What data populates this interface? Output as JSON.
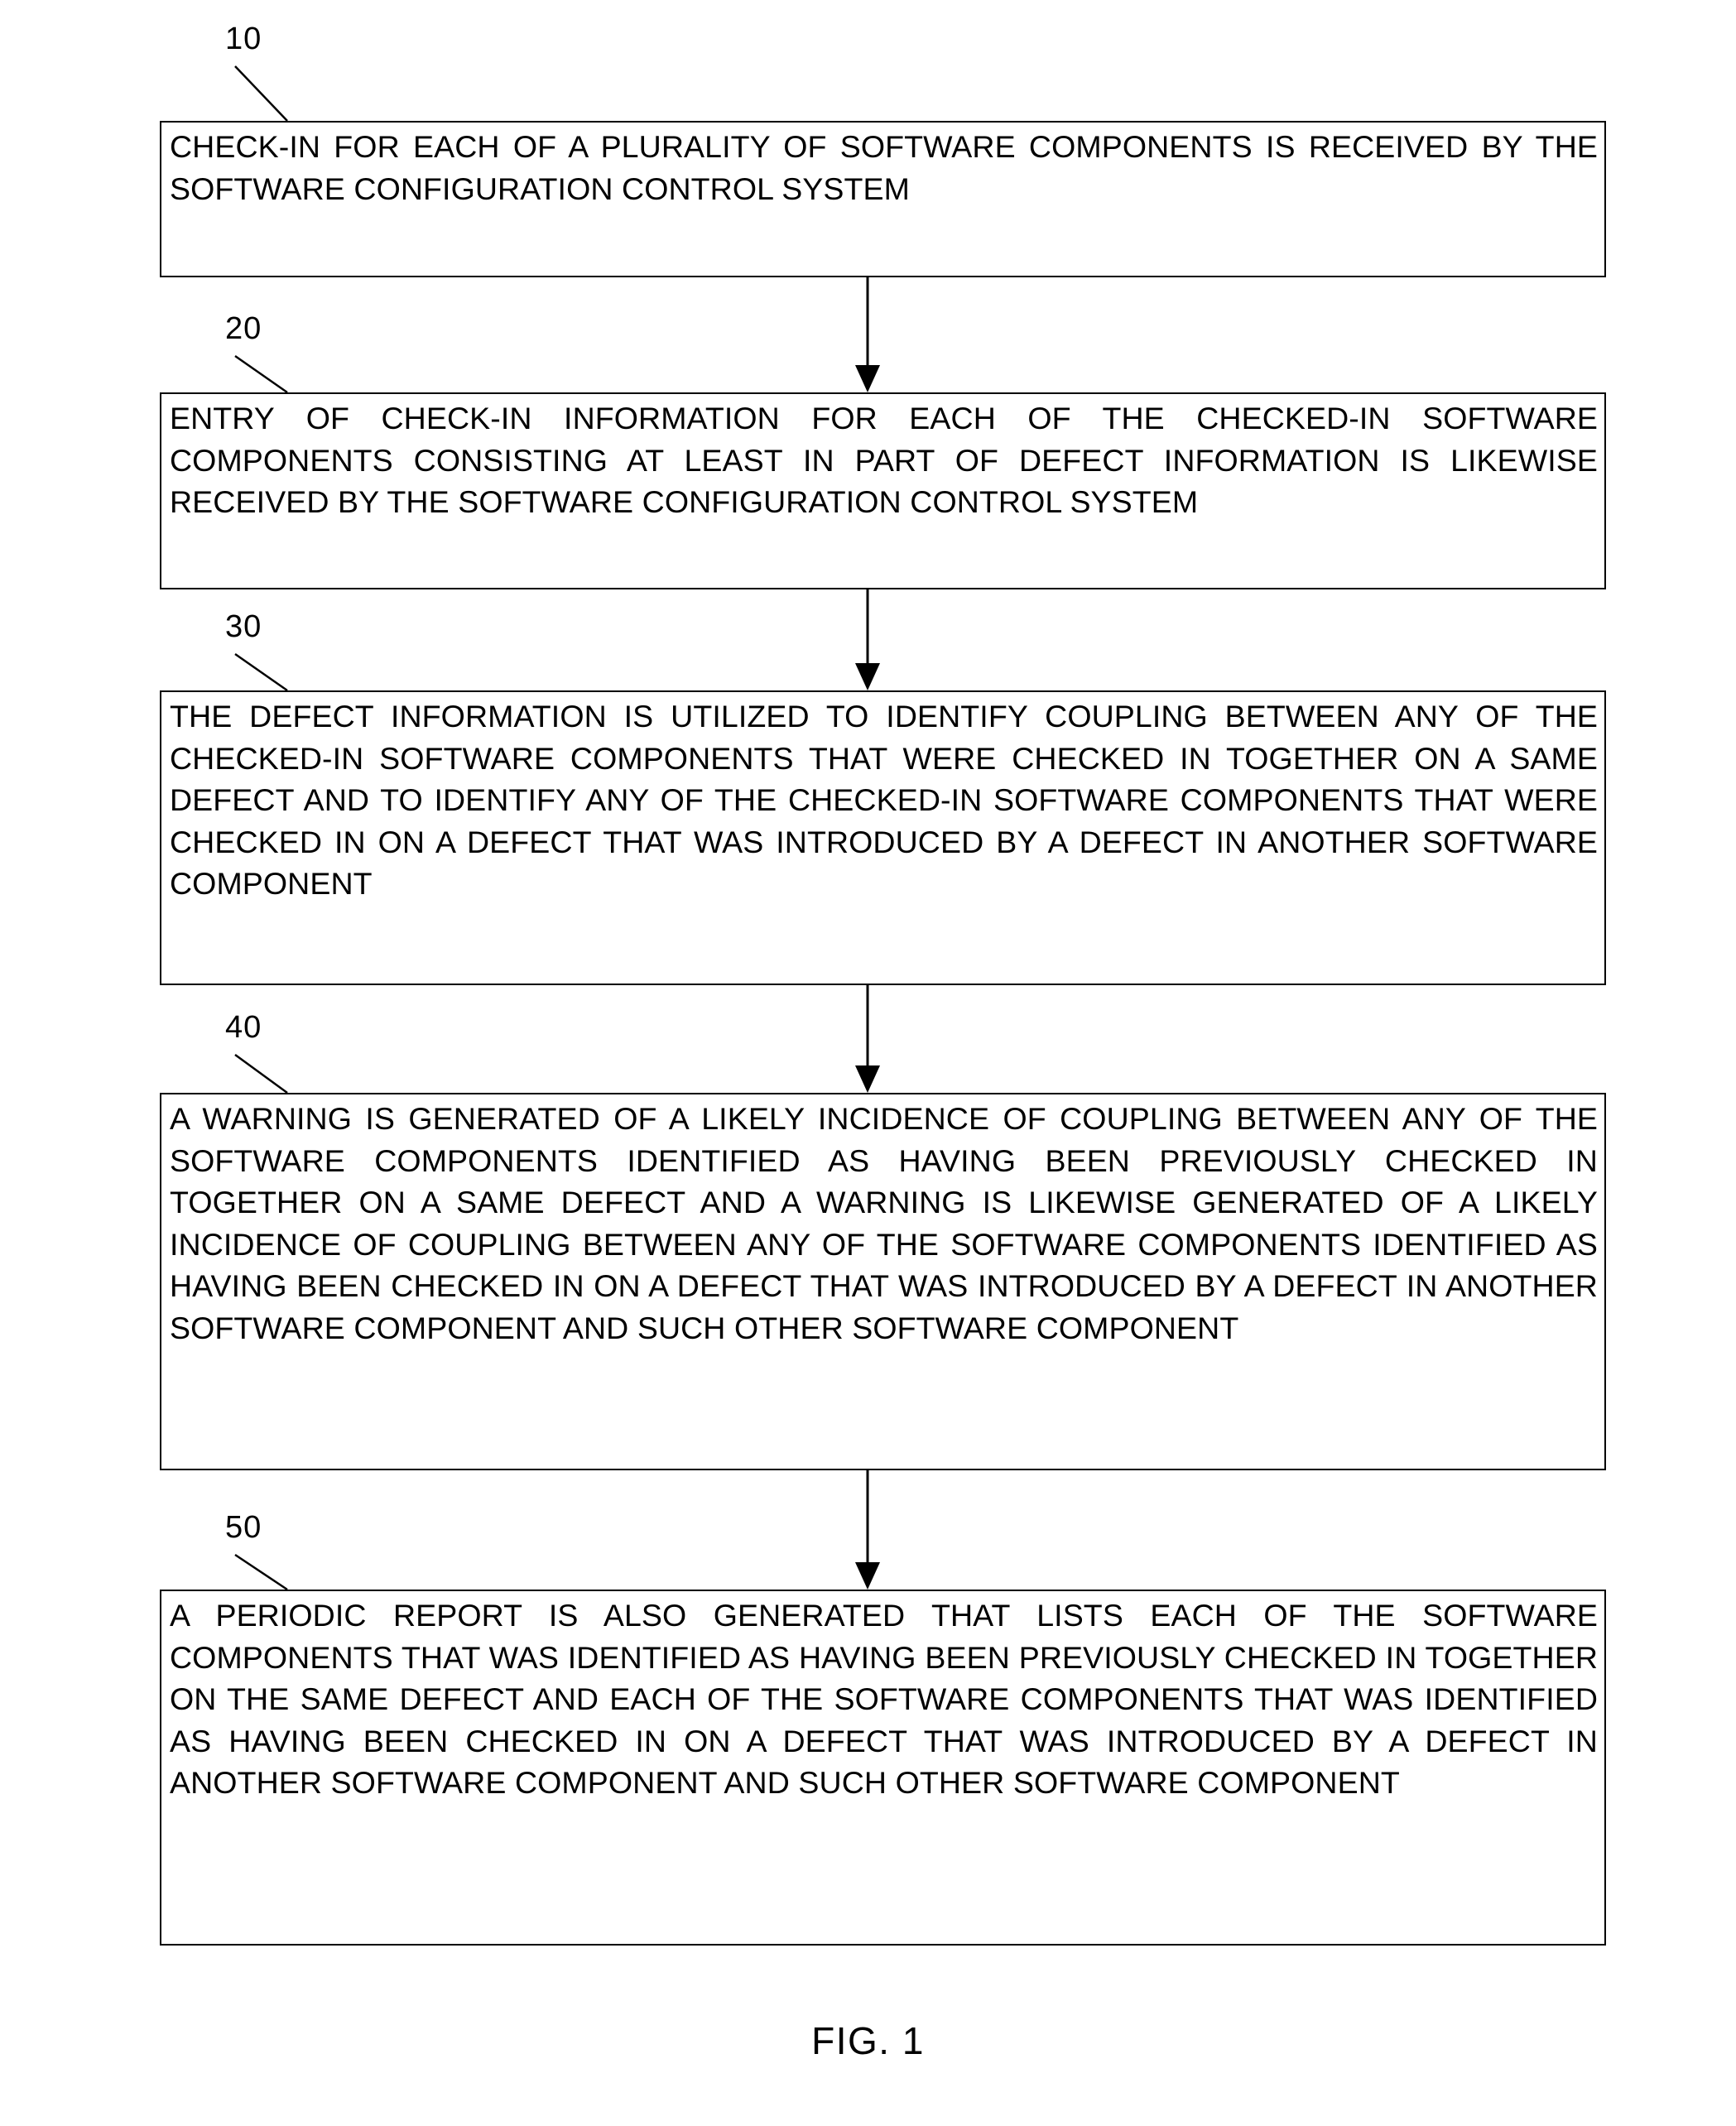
{
  "figure": {
    "caption": "FIG. 1",
    "type": "patent-flowchart",
    "orientation": "vertical"
  },
  "steps": [
    {
      "ref": "10",
      "text": "CHECK-IN FOR EACH OF A PLURALITY OF SOFTWARE COMPONENTS IS RECEIVED BY THE SOFTWARE CONFIGURATION CONTROL SYSTEM"
    },
    {
      "ref": "20",
      "text": "ENTRY OF CHECK-IN INFORMATION FOR EACH OF THE CHECKED-IN SOFTWARE COMPONENTS CONSISTING AT LEAST IN PART OF DEFECT INFORMATION IS LIKEWISE RECEIVED BY THE SOFTWARE CONFIGURATION CONTROL SYSTEM"
    },
    {
      "ref": "30",
      "text": "THE DEFECT INFORMATION IS UTILIZED TO IDENTIFY COUPLING BETWEEN ANY OF THE CHECKED-IN SOFTWARE COMPONENTS THAT WERE CHECKED IN TOGETHER ON A SAME DEFECT AND TO IDENTIFY ANY OF THE CHECKED-IN SOFTWARE COMPONENTS THAT WERE CHECKED IN ON A DEFECT THAT WAS INTRODUCED BY A DEFECT IN ANOTHER SOFTWARE COMPONENT"
    },
    {
      "ref": "40",
      "text": "A WARNING IS GENERATED OF A LIKELY INCIDENCE OF COUPLING BETWEEN ANY OF THE SOFTWARE COMPONENTS IDENTIFIED AS HAVING BEEN PREVIOUSLY CHECKED IN TOGETHER ON A SAME DEFECT AND A WARNING IS LIKEWISE GENERATED OF A LIKELY INCIDENCE OF COUPLING BETWEEN ANY OF THE SOFTWARE COMPONENTS IDENTIFIED AS HAVING BEEN CHECKED IN ON A DEFECT THAT WAS INTRODUCED BY A DEFECT IN ANOTHER SOFTWARE COMPONENT AND SUCH OTHER SOFTWARE COMPONENT"
    },
    {
      "ref": "50",
      "text": "A PERIODIC REPORT IS ALSO GENERATED THAT LISTS EACH OF THE SOFTWARE COMPONENTS THAT WAS IDENTIFIED AS HAVING BEEN PREVIOUSLY CHECKED IN TOGETHER ON THE SAME DEFECT AND EACH OF THE SOFTWARE COMPONENTS THAT WAS IDENTIFIED AS HAVING BEEN CHECKED IN ON A DEFECT THAT WAS INTRODUCED BY A DEFECT IN ANOTHER SOFTWARE COMPONENT AND SUCH OTHER SOFTWARE COMPONENT"
    }
  ],
  "colors": {
    "stroke": "#000000",
    "background": "#ffffff",
    "text": "#000000"
  }
}
